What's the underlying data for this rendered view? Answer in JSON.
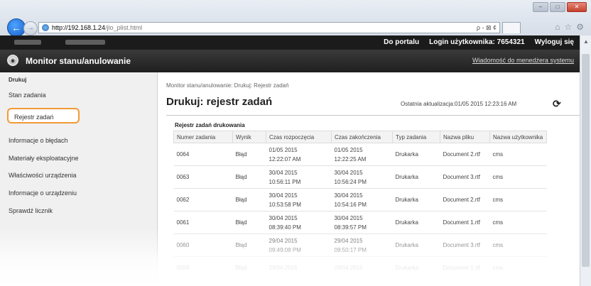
{
  "browser": {
    "url_host": "http://192.168.1.24",
    "url_path": "/jlo_plist.html",
    "address_tools": "ρ - ⊠ ¢"
  },
  "topbar": {
    "portal_link": "Do portalu",
    "user_label": "Login użytkownika:",
    "user_id": "7654321",
    "logout": "Wyloguj się"
  },
  "appbar": {
    "title": "Monitor stanu/anulowanie",
    "admin_message": "Wiadomość do menedżera systemu"
  },
  "sidebar": {
    "section": "Drukuj",
    "items": [
      {
        "label": "Stan zadania"
      },
      {
        "label": "Rejestr zadań"
      },
      {
        "label": "Informacje o błędach"
      },
      {
        "label": "Materiały eksploatacyjne"
      },
      {
        "label": "Właściwości urządzenia"
      },
      {
        "label": "Informacje o urządzeniu"
      },
      {
        "label": "Sprawdź licznik"
      }
    ]
  },
  "main": {
    "breadcrumb": "Monitor stanu/anulowanie: Drukuj: Rejestr zadań",
    "title": "Drukuj: rejestr zadań",
    "last_update": "Ostatnia aktualizacja:01/05 2015 12:23:16 AM",
    "panel_title": "Rejestr zadań drukowania",
    "columns": [
      "Numer zadania",
      "Wynik",
      "Czas rozpoczęcia",
      "Czas zakończenia",
      "Typ zadania",
      "Nazwa pliku",
      "Nazwa użytkownika"
    ],
    "rows": [
      {
        "num": "0064",
        "result": "Błąd",
        "start": "01/05 2015\n12:22:07 AM",
        "end": "01/05 2015\n12:22:25 AM",
        "type": "Drukarka",
        "file": "Document 2.rtf",
        "user": "cms"
      },
      {
        "num": "0063",
        "result": "Błąd",
        "start": "30/04 2015\n10:56:11 PM",
        "end": "30/04 2015\n10:56:24 PM",
        "type": "Drukarka",
        "file": "Document 3.rtf",
        "user": "cms"
      },
      {
        "num": "0062",
        "result": "Błąd",
        "start": "30/04 2015\n10:53:58 PM",
        "end": "30/04 2015\n10:54:16 PM",
        "type": "Drukarka",
        "file": "Document 2.rtf",
        "user": "cms"
      },
      {
        "num": "0061",
        "result": "Błąd",
        "start": "30/04 2015\n08:39:40 PM",
        "end": "30/04 2015\n08:39:57 PM",
        "type": "Drukarka",
        "file": "Document 1.rtf",
        "user": "cms"
      },
      {
        "num": "0060",
        "result": "Błąd",
        "start": "29/04 2015\n09:49:08 PM",
        "end": "29/04 2015\n09:50:17 PM",
        "type": "Drukarka",
        "file": "Document 3.rtf",
        "user": "cms"
      },
      {
        "num": "0059",
        "result": "Błąd",
        "start": "29/04 2015",
        "end": "29/04 2015",
        "type": "Drukarka",
        "file": "Document 1.rtf",
        "user": "cms"
      }
    ]
  }
}
